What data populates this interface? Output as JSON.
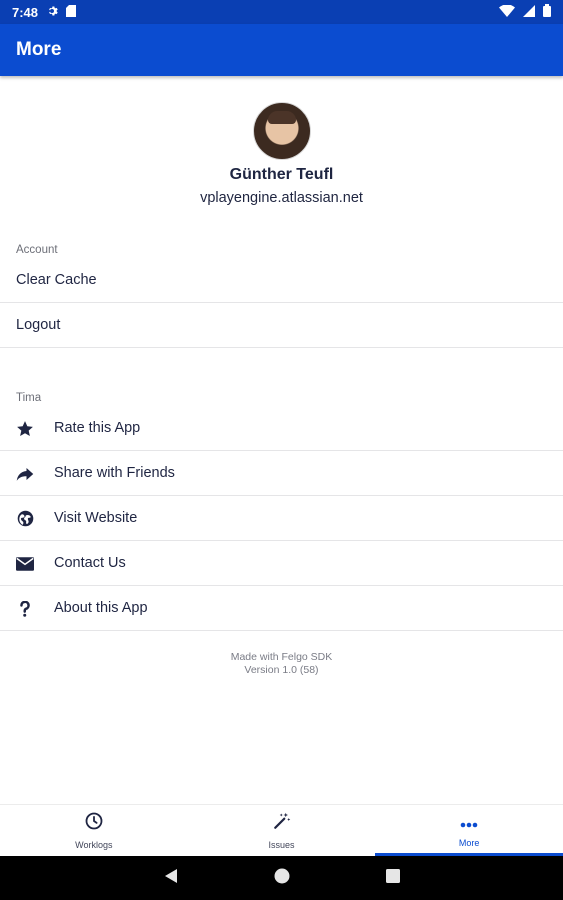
{
  "status_bar": {
    "time": "7:48"
  },
  "app_bar": {
    "title": "More"
  },
  "profile": {
    "name": "Günther Teufl",
    "site": "vplayengine.atlassian.net"
  },
  "account_section": {
    "label": "Account",
    "items": [
      {
        "label": "Clear Cache"
      },
      {
        "label": "Logout"
      }
    ]
  },
  "tima_section": {
    "label": "Tima",
    "items": [
      {
        "label": "Rate this App",
        "icon": "star-icon"
      },
      {
        "label": "Share with Friends",
        "icon": "share-icon"
      },
      {
        "label": "Visit Website",
        "icon": "globe-icon"
      },
      {
        "label": "Contact Us",
        "icon": "envelope-icon"
      },
      {
        "label": "About this App",
        "icon": "question-icon"
      }
    ]
  },
  "footer": {
    "line1": "Made with Felgo SDK",
    "line2": "Version 1.0 (58)"
  },
  "tabs": [
    {
      "label": "Worklogs",
      "icon": "clock-icon",
      "active": false
    },
    {
      "label": "Issues",
      "icon": "magic-wand-icon",
      "active": false
    },
    {
      "label": "More",
      "icon": "more-dots-icon",
      "active": true
    }
  ],
  "colors": {
    "primary": "#0b4cd0",
    "status_bar": "#0a3fb3",
    "text": "#1f2542"
  }
}
